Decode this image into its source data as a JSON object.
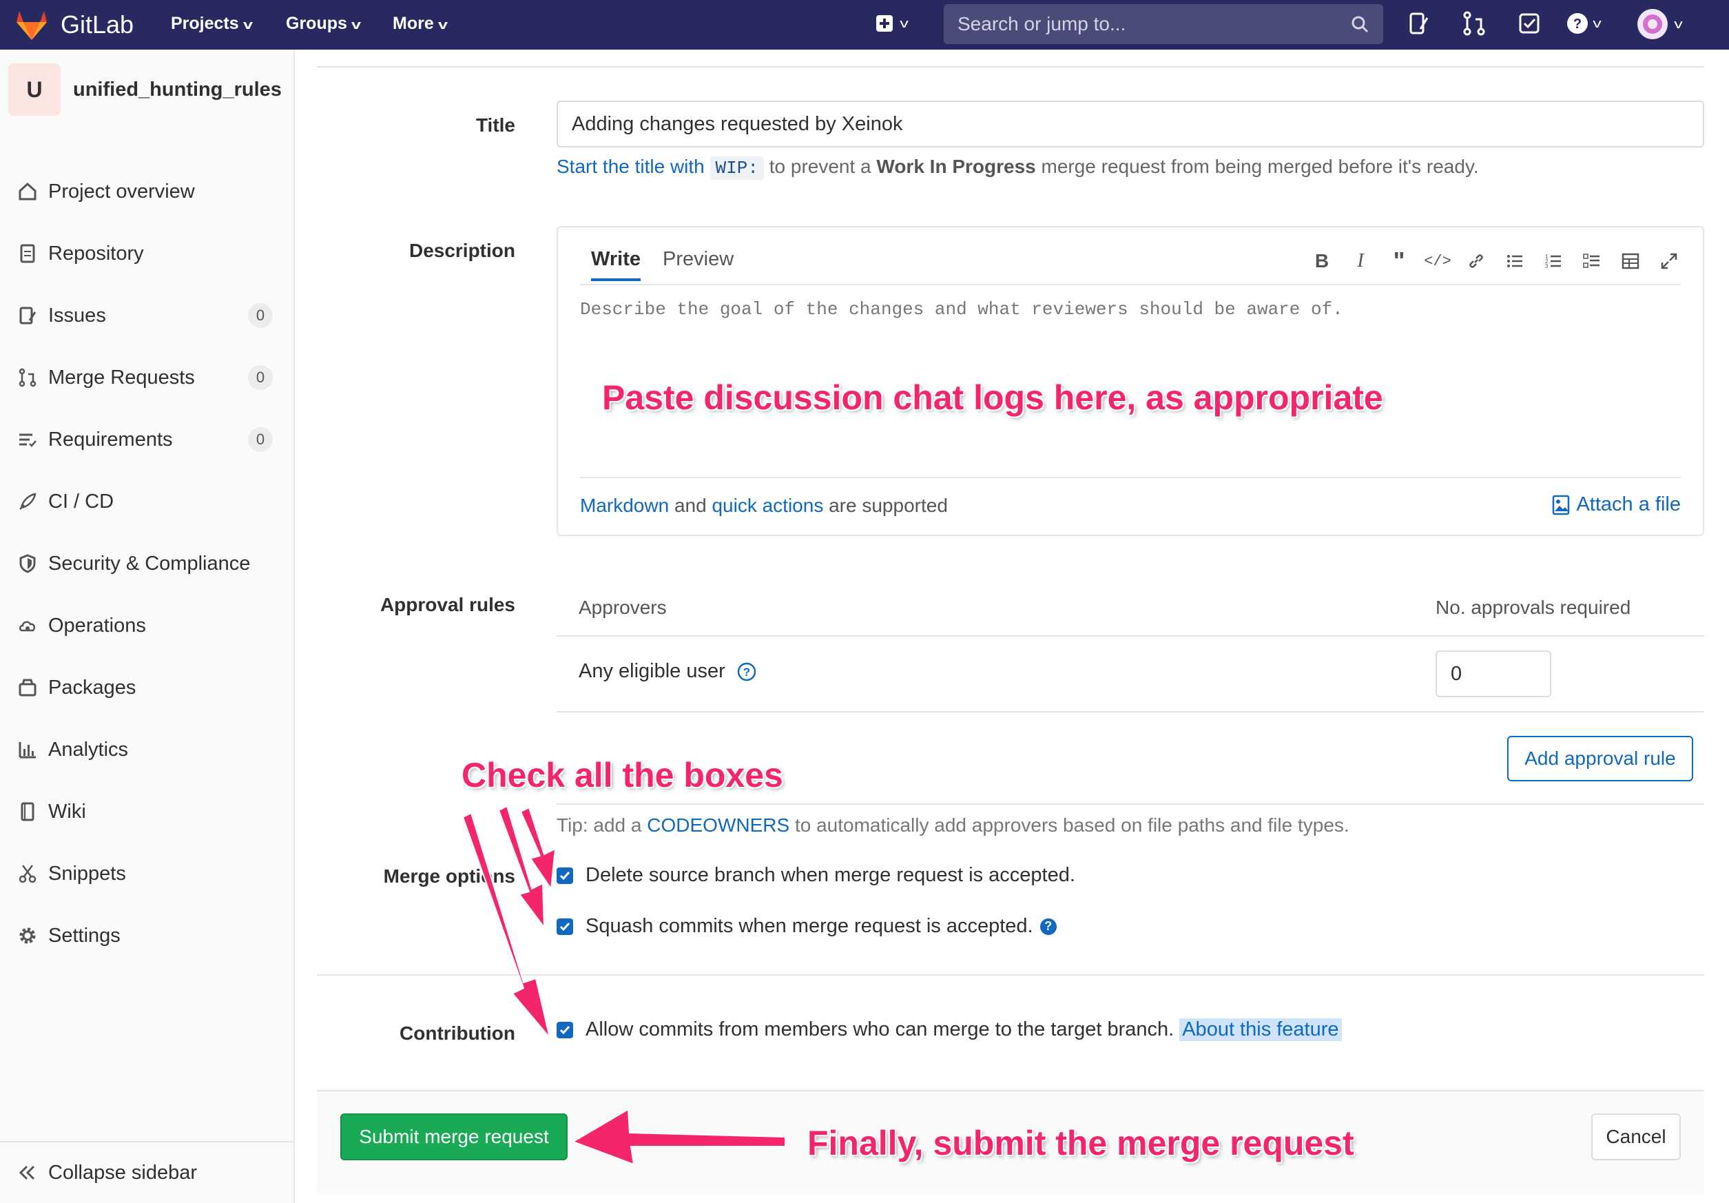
{
  "nav": {
    "brand": "GitLab",
    "menus": [
      "Projects",
      "Groups",
      "More"
    ],
    "search_placeholder": "Search or jump to..."
  },
  "sidebar": {
    "project_initial": "U",
    "project_name": "unified_hunting_rules",
    "items": [
      {
        "label": "Project overview",
        "icon": "home-icon"
      },
      {
        "label": "Repository",
        "icon": "document-icon"
      },
      {
        "label": "Issues",
        "icon": "issues-icon",
        "count": "0"
      },
      {
        "label": "Merge Requests",
        "icon": "merge-request-icon",
        "count": "0"
      },
      {
        "label": "Requirements",
        "icon": "requirements-icon",
        "count": "0"
      },
      {
        "label": "CI / CD",
        "icon": "rocket-icon"
      },
      {
        "label": "Security & Compliance",
        "icon": "shield-icon"
      },
      {
        "label": "Operations",
        "icon": "cloud-gear-icon"
      },
      {
        "label": "Packages",
        "icon": "package-icon"
      },
      {
        "label": "Analytics",
        "icon": "bar-chart-icon"
      },
      {
        "label": "Wiki",
        "icon": "book-icon"
      },
      {
        "label": "Snippets",
        "icon": "scissors-icon"
      },
      {
        "label": "Settings",
        "icon": "gear-icon"
      }
    ],
    "collapse_label": "Collapse sidebar"
  },
  "form": {
    "title_label": "Title",
    "title_value": "Adding changes requested by Xeinok",
    "title_hint_prefix": "Start the title with",
    "title_hint_code": "WIP:",
    "title_hint_mid": "to prevent a",
    "title_hint_bold": "Work In Progress",
    "title_hint_suffix": "merge request from being merged before it's ready.",
    "description_label": "Description",
    "tab_write": "Write",
    "tab_preview": "Preview",
    "description_placeholder": "Describe the goal of the changes and what reviewers should be aware of.",
    "markdown_link": "Markdown",
    "and_text": "and",
    "quick_actions_link": "quick actions",
    "supported_text": "are supported",
    "attach_label": "Attach a file",
    "approval_label": "Approval rules",
    "approvers_header": "Approvers",
    "approvals_required_header": "No. approvals required",
    "eligible_user": "Any eligible user",
    "approvals_value": "0",
    "add_rule_label": "Add approval rule",
    "tip_prefix": "Tip: add a",
    "tip_link": "CODEOWNERS",
    "tip_suffix": "to automatically add approvers based on file paths and file types.",
    "merge_options_label": "Merge options",
    "opt_delete": "Delete source branch when merge request is accepted.",
    "opt_squash": "Squash commits when merge request is accepted.",
    "contribution_label": "Contribution",
    "opt_allow": "Allow commits from members who can merge to the target branch.",
    "about_link": "About this feature",
    "submit_label": "Submit merge request",
    "cancel_label": "Cancel"
  },
  "annotations": {
    "paste": "Paste discussion chat logs here, as appropriate",
    "check": "Check all the boxes",
    "submit": "Finally, submit the merge request"
  },
  "colors": {
    "nav_bg": "#292961",
    "link": "#1068bf",
    "submit": "#1aaa55",
    "annotation": "#f5256a"
  }
}
